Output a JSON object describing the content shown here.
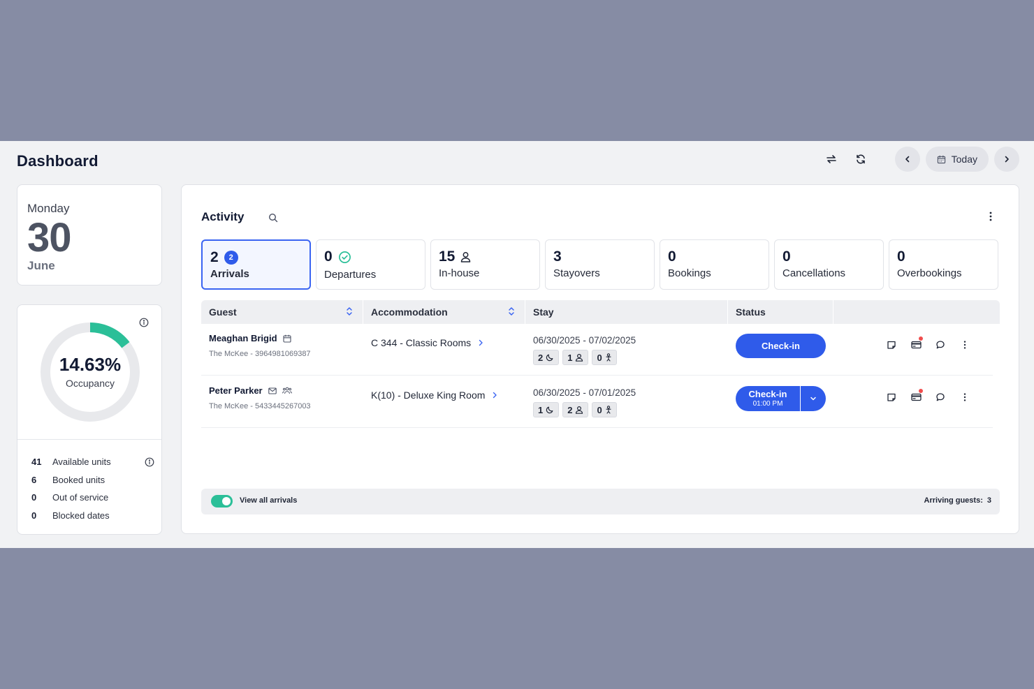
{
  "header": {
    "title": "Dashboard",
    "today_label": "Today"
  },
  "date_card": {
    "weekday": "Monday",
    "day": "30",
    "month": "June"
  },
  "occupancy": {
    "percent_label": "14.63%",
    "percent_value": 14.63,
    "label": "Occupancy",
    "accent_color": "#2bbf98",
    "track_color": "#e8e9ec",
    "stats": [
      {
        "value": "41",
        "label": "Available units"
      },
      {
        "value": "6",
        "label": "Booked units"
      },
      {
        "value": "0",
        "label": "Out of service"
      },
      {
        "value": "0",
        "label": "Blocked dates"
      }
    ]
  },
  "activity": {
    "title": "Activity",
    "tabs": [
      {
        "count": "2",
        "label": "Arrivals",
        "badge": "2"
      },
      {
        "count": "0",
        "label": "Departures"
      },
      {
        "count": "15",
        "label": "In-house"
      },
      {
        "count": "3",
        "label": "Stayovers"
      },
      {
        "count": "0",
        "label": "Bookings"
      },
      {
        "count": "0",
        "label": "Cancellations"
      },
      {
        "count": "0",
        "label": "Overbookings"
      }
    ],
    "columns": {
      "guest": "Guest",
      "accommodation": "Accommodation",
      "stay": "Stay",
      "status": "Status"
    },
    "rows": [
      {
        "guest": "Meaghan Brigid",
        "sub": "The McKee - 3964981069387",
        "accommodation": "C 344 - Classic Rooms",
        "stay": "06/30/2025 - 07/02/2025",
        "nights": "2",
        "adults": "1",
        "children": "0",
        "button": "Check-in"
      },
      {
        "guest": "Peter Parker",
        "sub": "The McKee - 5433445267003",
        "accommodation": "K(10) - Deluxe King Room",
        "stay": "06/30/2025 - 07/01/2025",
        "nights": "1",
        "adults": "2",
        "children": "0",
        "button": "Check-in",
        "button_time": "01:00 PM"
      }
    ],
    "footer": {
      "toggle_label": "View all arrivals",
      "arriving_label": "Arriving guests:",
      "arriving_count": "3"
    }
  },
  "colors": {
    "primary": "#2f5bea",
    "accent": "#2bbf98",
    "notify": "#f04d4d"
  }
}
